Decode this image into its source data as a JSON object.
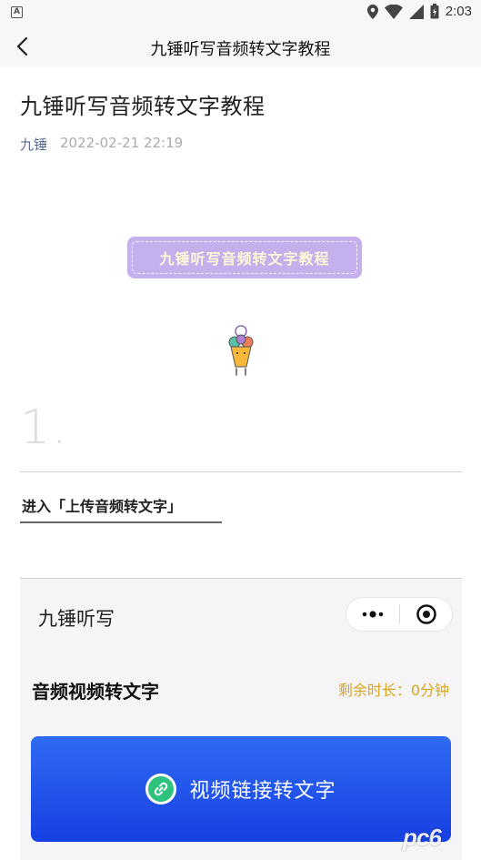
{
  "status_bar": {
    "left_icon_letter": "A",
    "time": "2:03",
    "icons": [
      "location-icon",
      "wifi-icon",
      "signal-icon",
      "battery-icon"
    ]
  },
  "nav": {
    "back_icon": "chevron-left-icon",
    "title": "九锤听写音频转文字教程"
  },
  "article": {
    "title": "九锤听写音频转文字教程",
    "author": "九锤",
    "date": "2022-02-21 22:19",
    "banner_text": "九锤听写音频转文字教程",
    "step_number": "1.",
    "step_text": "进入「上传音频转文字」"
  },
  "embedded_screenshot": {
    "app_name": "九锤听写",
    "section_title": "音频视频转文字",
    "remaining_label": "剩余时长：0分钟",
    "button_label": "视频链接转文字",
    "button_icon": "link-icon"
  },
  "watermark": "pc6",
  "colors": {
    "banner_bg": "#c5b0ee",
    "banner_text": "#fff8d6",
    "author_link": "#576b95",
    "remaining_text": "#d7a61d",
    "button_gradient_top": "#2f6bf2",
    "button_gradient_bottom": "#1740e3",
    "link_icon_bg": "#2ec27e"
  }
}
